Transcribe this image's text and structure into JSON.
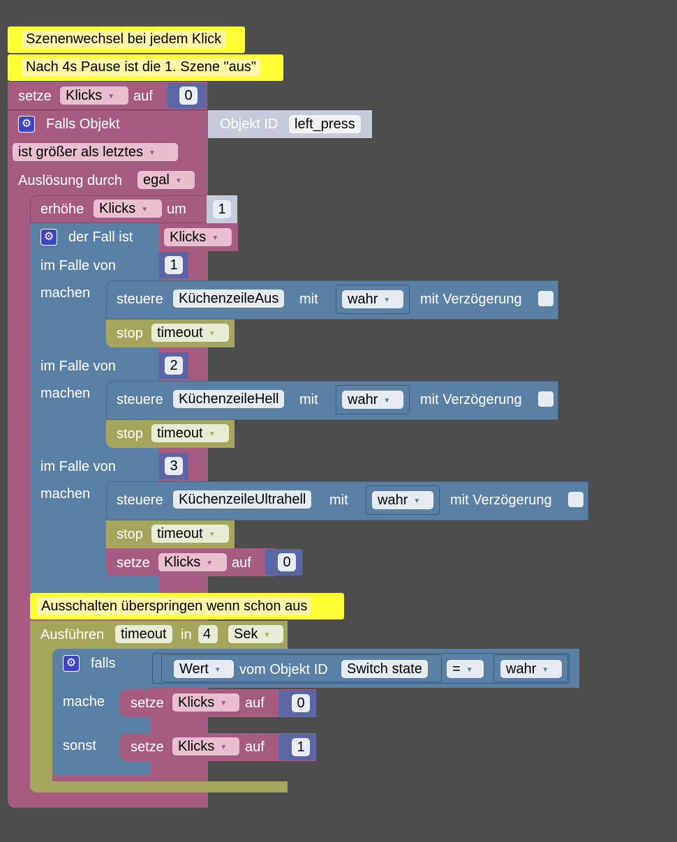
{
  "comments": {
    "c1": "Szenenwechsel bei jedem Klick",
    "c2": "Nach 4s Pause ist die 1. Szene \"aus\"",
    "c3": "Ausschalten überspringen wenn schon aus"
  },
  "setze_top": {
    "label": "setze",
    "var": "Klicks",
    "auf": "auf",
    "value": "0"
  },
  "trigger": {
    "title": "Falls Objekt",
    "objekt_id_label": "Objekt ID",
    "objekt_id": "left_press",
    "condition": "ist größer als letztes",
    "ausloesung_label": "Auslösung durch",
    "ausloesung_value": "egal"
  },
  "increment": {
    "label": "erhöhe",
    "var": "Klicks",
    "um": "um",
    "value": "1"
  },
  "switch": {
    "label": "der Fall ist",
    "var": "Klicks",
    "case_label": "im Falle von",
    "do_label": "machen",
    "cases": [
      {
        "value": "1",
        "steuere": "steuere",
        "object": "KüchenzeileAus",
        "mit": "mit",
        "state": "wahr",
        "delay": "mit Verzögerung",
        "stop": "stop",
        "timeout": "timeout"
      },
      {
        "value": "2",
        "steuere": "steuere",
        "object": "KüchenzeileHell",
        "mit": "mit",
        "state": "wahr",
        "delay": "mit Verzögerung",
        "stop": "stop",
        "timeout": "timeout"
      },
      {
        "value": "3",
        "steuere": "steuere",
        "object": "KüchenzeileUltrahell",
        "mit": "mit",
        "state": "wahr",
        "delay": "mit Verzögerung",
        "stop": "stop",
        "timeout": "timeout"
      }
    ],
    "reset": {
      "label": "setze",
      "var": "Klicks",
      "auf": "auf",
      "value": "0"
    }
  },
  "timeout": {
    "label": "Ausführen",
    "name": "timeout",
    "in": "in",
    "value": "4",
    "unit": "Sek"
  },
  "if_block": {
    "falls": "falls",
    "mache": "mache",
    "sonst": "sonst",
    "wert": "Wert",
    "vom_objekt": "vom Objekt ID",
    "object": "Switch state",
    "operator": "=",
    "compare": "wahr",
    "then": {
      "label": "setze",
      "var": "Klicks",
      "auf": "auf",
      "value": "0"
    },
    "else": {
      "label": "setze",
      "var": "Klicks",
      "auf": "auf",
      "value": "1"
    }
  },
  "colors": {
    "pink": "#a65c81",
    "blue": "#5b80a5",
    "olive": "#a5a55b",
    "comment": "#ffff33",
    "background": "#4d4d4d"
  }
}
